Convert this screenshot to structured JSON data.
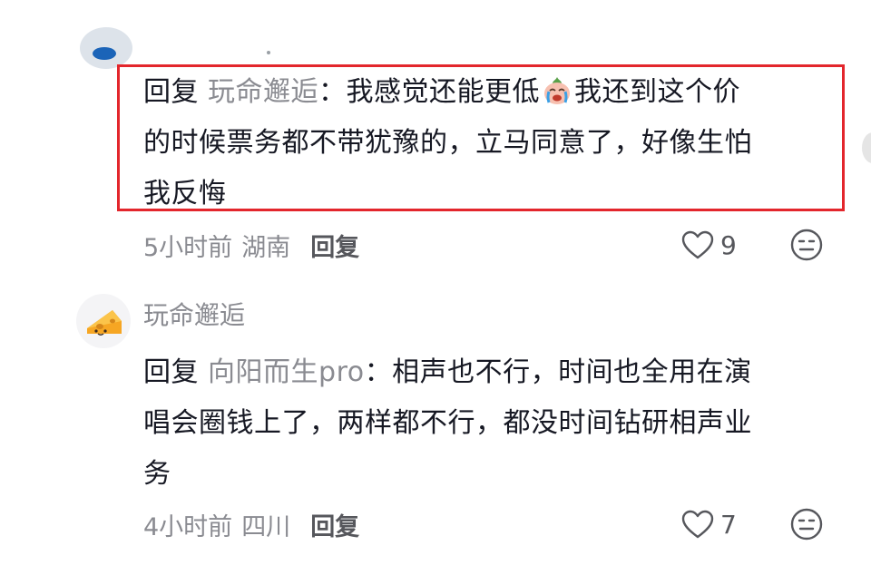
{
  "comment1": {
    "reply_word": "回复",
    "mention": "玩命邂逅",
    "colon": "：",
    "text_part1": "我感觉还能更低",
    "text_part2": "我还到这个价",
    "line2": "的时候票务都不带犹豫的，立马同意了，好像生怕",
    "line3": "我反悔",
    "emoji": "crying-face-emoji",
    "time": "5小时前",
    "location": "湖南",
    "reply_label": "回复",
    "likes": "9"
  },
  "comment2": {
    "username": "玩命邂逅",
    "avatar": "cheese-avatar",
    "reply_word": "回复",
    "mention": "向阳而生pro",
    "colon": "：",
    "line1_text": "相声也不行，时间也全用在演",
    "line2": "唱会圈钱上了，两样都不行，都没时间钻研相声业",
    "line3": "务",
    "time": "4小时前",
    "location": "四川",
    "reply_label": "回复",
    "likes": "7"
  },
  "colors": {
    "highlight_border": "#e3262c",
    "text_primary": "#161823",
    "text_secondary": "#8a8b91"
  }
}
